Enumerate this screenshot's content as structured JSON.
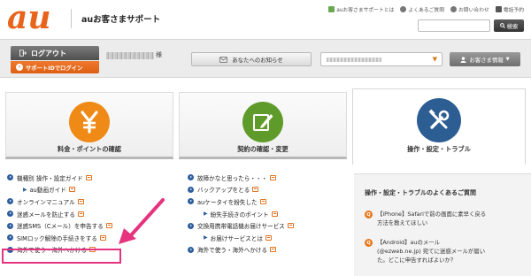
{
  "header": {
    "logo_text": "au",
    "site_name": "auお客さまサポート",
    "util_links": [
      {
        "label": "auお客さまサポートとは",
        "icon": "leaf-icon",
        "color": "#6aa84f"
      },
      {
        "label": "よくあるご質問",
        "icon": "question-icon",
        "color": "#777777"
      },
      {
        "label": "お問い合わせ",
        "icon": "mail-icon",
        "color": "#777777"
      },
      {
        "label": "電話予約",
        "icon": "phone-icon",
        "color": "#555555"
      }
    ],
    "search_placeholder": "",
    "search_label": "検索"
  },
  "login_bar": {
    "logout_label": "ログアウト",
    "sid_label": "サポートIDでログイン",
    "user_suffix": "様",
    "notice_label": "あなたへのお知らせ",
    "member_label": "お客さま情報"
  },
  "tabs": [
    {
      "label": "料金・ポイントの確認",
      "icon": "yen-icon",
      "color": "#ef8a16",
      "active": false
    },
    {
      "label": "契約の確認・変更",
      "icon": "pencil-icon",
      "color": "#5f9b2a",
      "active": false
    },
    {
      "label": "操作・設定・トラブル",
      "icon": "tools-icon",
      "color": "#2c5d93",
      "active": true
    }
  ],
  "left_links": [
    {
      "label": "機種別 操作・設定ガイド",
      "sub": false
    },
    {
      "label": "au動画ガイド",
      "sub": true
    },
    {
      "label": "オンラインマニュアル",
      "sub": false
    },
    {
      "label": "迷惑メールを防止する",
      "sub": false
    },
    {
      "label": "迷惑SMS（Cメール）を申告する",
      "sub": false
    },
    {
      "label": "SIMロック解除の手続きをする",
      "sub": false
    },
    {
      "label": "海外で使う・海外へかける",
      "sub": false
    }
  ],
  "middle_links": [
    {
      "label": "故障かなと思ったら・・・",
      "sub": false
    },
    {
      "label": "バックアップをとる",
      "sub": false
    },
    {
      "label": "auケータイを紛失した",
      "sub": false
    },
    {
      "label": "紛失手続きのポイント",
      "sub": true
    },
    {
      "label": "交換用携帯電話機お届けサービス",
      "sub": false
    },
    {
      "label": "お届けサービスとは",
      "sub": true
    },
    {
      "label": "海外で使う・海外へかける",
      "sub": false
    }
  ],
  "faq": {
    "title": "操作・設定・トラブルのよくあるご質問",
    "items": [
      {
        "mark": "Q",
        "lines": [
          "【iPhone】Safariで前の画面に素早く戻る",
          "方法を教えてほしい"
        ]
      },
      {
        "mark": "Q",
        "lines": [
          "【Android】auのメール",
          "(@ezweb.ne.jp) 宛てに迷惑メールが届い",
          "た。どこに申告すればよいか？"
        ]
      }
    ]
  },
  "colors": {
    "brand_orange": "#e8641b",
    "link_blue": "#2f5f9e",
    "highlight_pink": "#e5337f"
  }
}
